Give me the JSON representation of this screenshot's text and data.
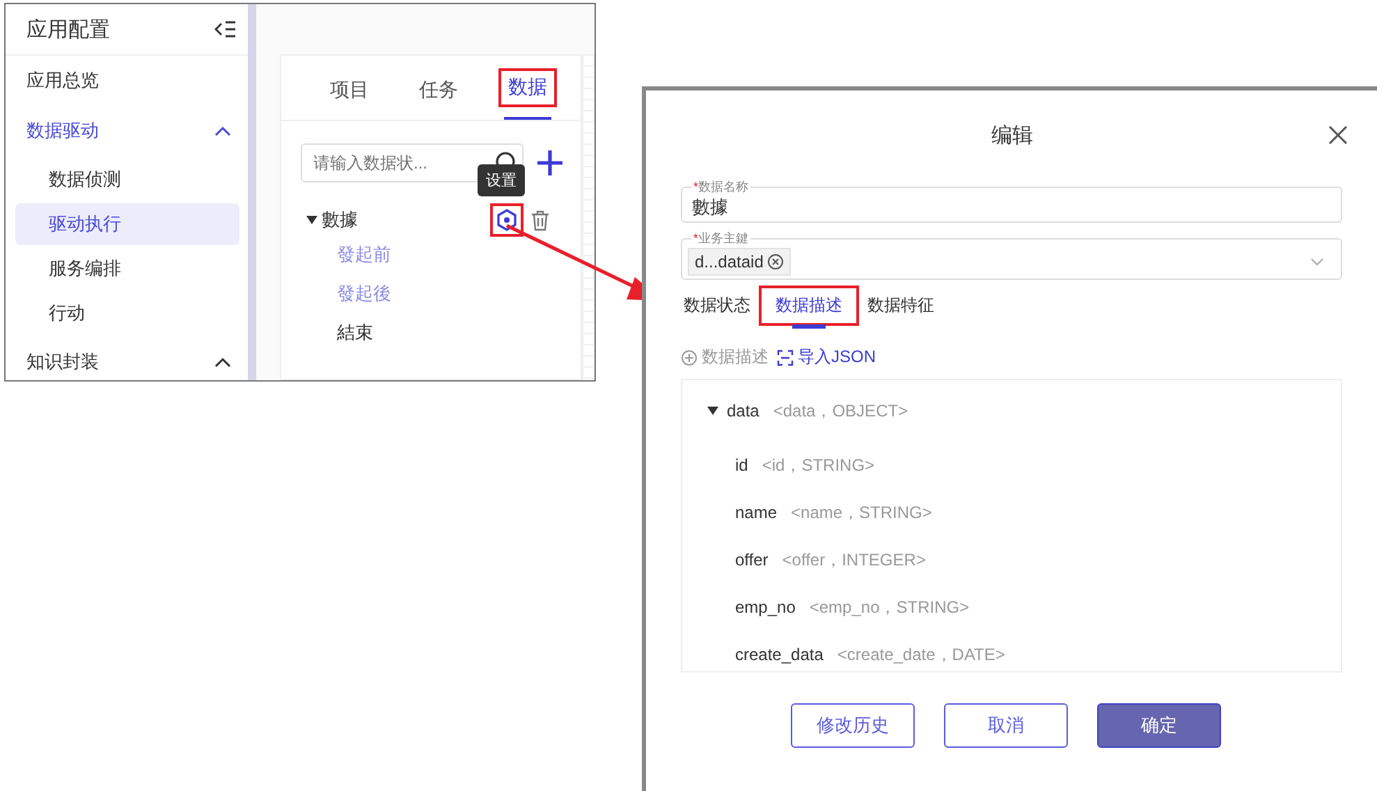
{
  "left_panel": {
    "title": "应用配置",
    "sidebar": {
      "items": [
        {
          "label": "应用总览",
          "selected": false
        },
        {
          "label": "数据驱动",
          "selected": true,
          "expanded": true,
          "children": [
            {
              "label": "数据侦测",
              "selected": false
            },
            {
              "label": "驱动执行",
              "selected": true
            },
            {
              "label": "服务编排",
              "selected": false
            },
            {
              "label": "行动",
              "selected": false
            }
          ]
        },
        {
          "label": "知识封装",
          "selected": false,
          "expanded": true
        }
      ]
    },
    "tabs": [
      {
        "label": "项目",
        "selected": false,
        "annotated": false
      },
      {
        "label": "任务",
        "selected": false,
        "annotated": false
      },
      {
        "label": "数据",
        "selected": true,
        "annotated": true
      }
    ],
    "search": {
      "placeholder": "请输入数据状..."
    },
    "tooltip": "设置",
    "settings_annotated": true,
    "tree": [
      {
        "label": "數據",
        "expanded": true,
        "children": [
          {
            "label": "發起前",
            "kind": "link"
          },
          {
            "label": "發起後",
            "kind": "link"
          },
          {
            "label": "結束",
            "kind": "plain"
          }
        ]
      }
    ]
  },
  "dialog": {
    "title": "编辑",
    "fields": [
      {
        "label": "数据名称",
        "required_mark": "*",
        "kind": "text",
        "value": "數據"
      },
      {
        "label": "业务主鍵",
        "required_mark": "*",
        "kind": "select",
        "tags": [
          "d...dataid"
        ]
      }
    ],
    "tabs": [
      {
        "label": "数据状态",
        "selected": false,
        "annotated": false
      },
      {
        "label": "数据描述",
        "selected": true,
        "annotated": true
      },
      {
        "label": "数据特征",
        "selected": false,
        "annotated": false
      }
    ],
    "actions": [
      {
        "label": "数据描述",
        "kind": "add",
        "disabled": true
      },
      {
        "label": "导入JSON",
        "kind": "import",
        "disabled": false
      }
    ],
    "schema": {
      "name": "data",
      "type": "<data，OBJECT>",
      "expanded": true,
      "children": [
        {
          "name": "id",
          "type": "<id，STRING>"
        },
        {
          "name": "name",
          "type": "<name，STRING>"
        },
        {
          "name": "offer",
          "type": "<offer，INTEGER>"
        },
        {
          "name": "emp_no",
          "type": "<emp_no，STRING>"
        },
        {
          "name": "create_data",
          "type": "<create_date，DATE>"
        }
      ]
    },
    "buttons": [
      {
        "label": "修改历史",
        "kind": "outline"
      },
      {
        "label": "取消",
        "kind": "outline"
      },
      {
        "label": "确定",
        "kind": "primary"
      }
    ]
  }
}
